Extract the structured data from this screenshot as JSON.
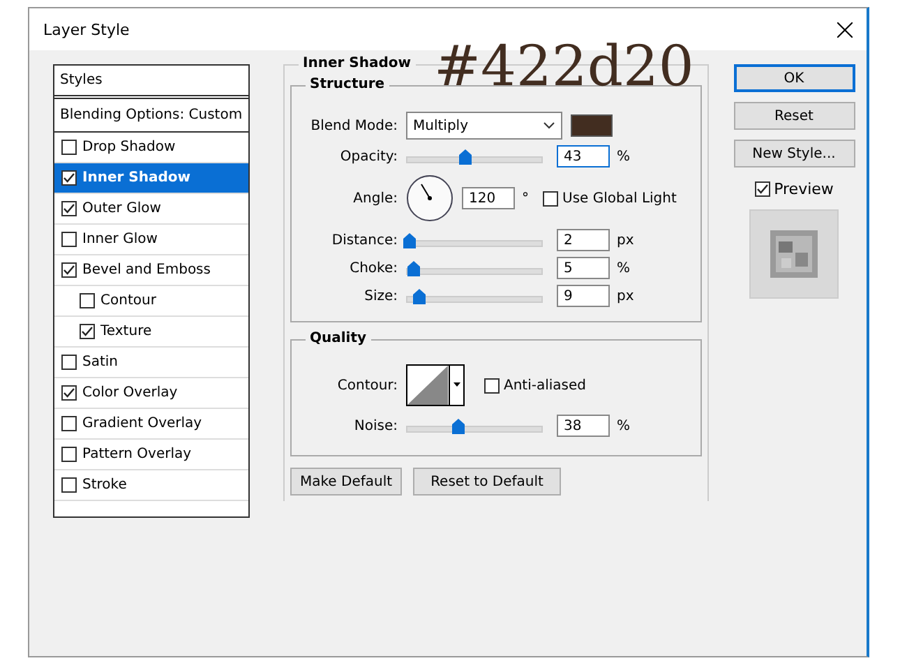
{
  "window": {
    "title": "Layer Style"
  },
  "annotation": {
    "text": "#422d20"
  },
  "styles": {
    "header": "Styles",
    "blending": "Blending Options: Custom",
    "items": [
      {
        "label": "Drop Shadow",
        "checked": false,
        "selected": false
      },
      {
        "label": "Inner Shadow",
        "checked": true,
        "selected": true
      },
      {
        "label": "Outer Glow",
        "checked": true,
        "selected": false
      },
      {
        "label": "Inner Glow",
        "checked": false,
        "selected": false
      },
      {
        "label": "Bevel and Emboss",
        "checked": true,
        "selected": false,
        "children": [
          {
            "label": "Contour",
            "checked": false,
            "selected": false
          },
          {
            "label": "Texture",
            "checked": true,
            "selected": false
          }
        ]
      },
      {
        "label": "Satin",
        "checked": false,
        "selected": false
      },
      {
        "label": "Color Overlay",
        "checked": true,
        "selected": false
      },
      {
        "label": "Gradient Overlay",
        "checked": false,
        "selected": false
      },
      {
        "label": "Pattern Overlay",
        "checked": false,
        "selected": false
      },
      {
        "label": "Stroke",
        "checked": false,
        "selected": false
      }
    ]
  },
  "panel": {
    "title": "Inner Shadow",
    "structure": {
      "title": "Structure",
      "blend_mode": {
        "label": "Blend Mode:",
        "value": "Multiply",
        "color": "#422d20"
      },
      "rows": [
        {
          "kind": "slider",
          "label": "Opacity:",
          "level": 0.43,
          "value": "43",
          "unit": "%",
          "focused": true
        },
        {
          "kind": "angle",
          "label": "Angle:",
          "value": "120",
          "unit": "°",
          "option": {
            "label": "Use Global Light",
            "checked": false
          }
        },
        {
          "kind": "slider",
          "label": "Distance:",
          "level": 0.02,
          "value": "2",
          "unit": "px",
          "focused": false
        },
        {
          "kind": "slider",
          "label": "Choke:",
          "level": 0.05,
          "value": "5",
          "unit": "%",
          "focused": false
        },
        {
          "kind": "slider",
          "label": "Size:",
          "level": 0.09,
          "value": "9",
          "unit": "px",
          "focused": false
        }
      ]
    },
    "quality": {
      "title": "Quality",
      "contour_label": "Contour:",
      "anti_aliased": {
        "label": "Anti-aliased",
        "checked": false
      },
      "noise": {
        "label": "Noise:",
        "level": 0.38,
        "value": "38",
        "unit": "%",
        "focused": false
      }
    },
    "buttons": [
      "Make Default",
      "Reset to Default"
    ]
  },
  "actions": [
    {
      "label": "OK",
      "default": true
    },
    {
      "label": "Reset",
      "default": false
    },
    {
      "label": "New Style...",
      "default": false
    }
  ],
  "preview": {
    "label": "Preview",
    "checked": true
  }
}
